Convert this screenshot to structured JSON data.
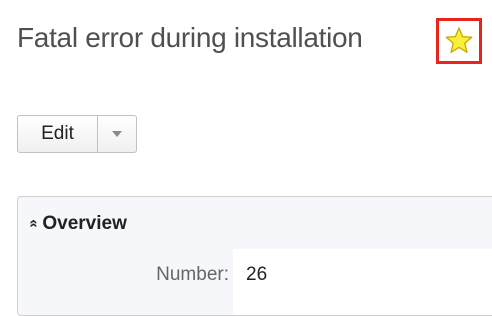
{
  "record": {
    "title": "Fatal error during installation",
    "favorite_icon": "star-icon",
    "favorite_color": "#f7ef3a",
    "highlight_color": "#e8251c"
  },
  "actions": {
    "edit_label": "Edit",
    "dropdown_icon": "chevron-down-icon"
  },
  "panel": {
    "header_icon": "double-chevron-up-icon",
    "header_label": "Overview",
    "fields": [
      {
        "label": "Number:",
        "value": "26"
      }
    ]
  }
}
